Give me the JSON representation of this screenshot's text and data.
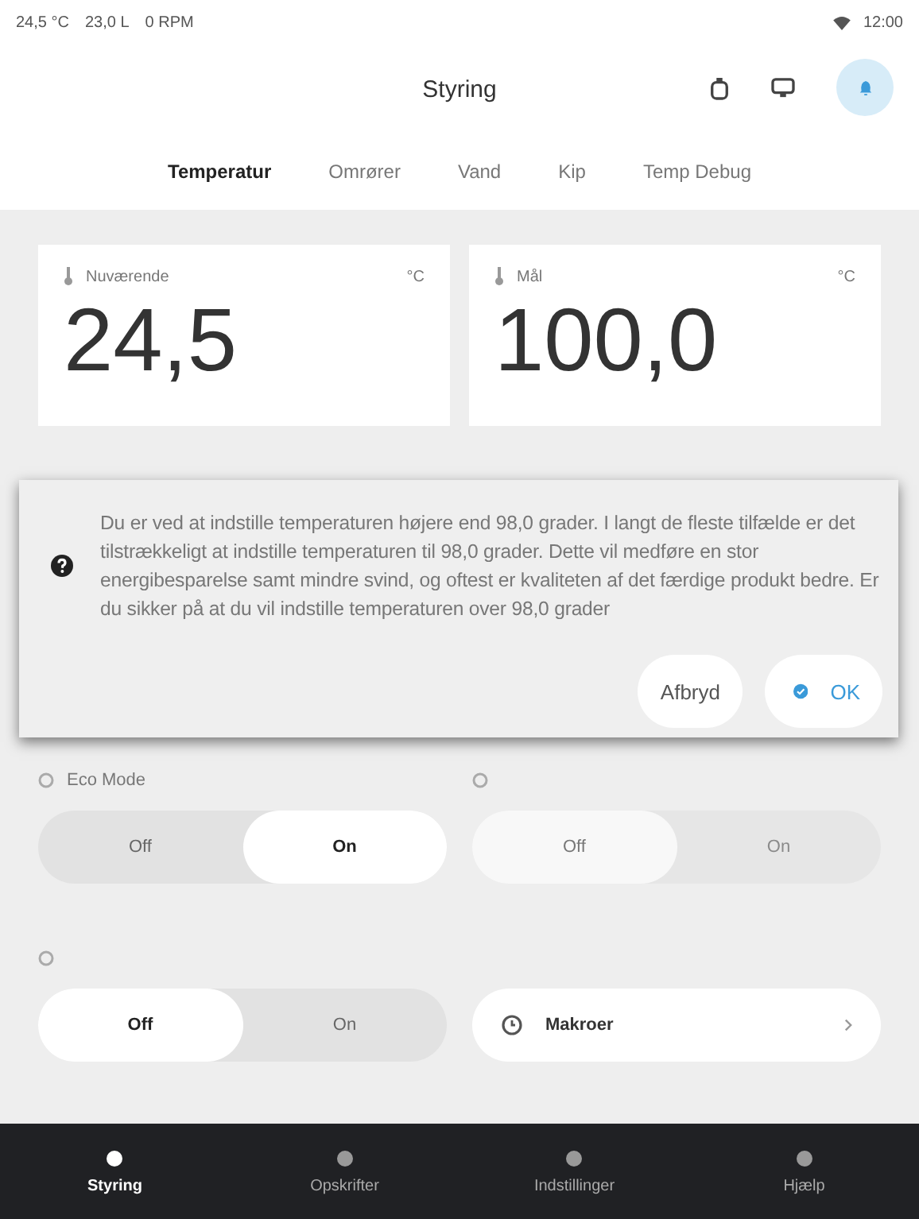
{
  "status_bar": {
    "readings": [
      "24,5 °C",
      "23,0 L",
      "0 RPM"
    ],
    "time": "12:00"
  },
  "app_bar": {
    "title": "Styring"
  },
  "tabs": [
    {
      "label": "Temperatur",
      "selected": true
    },
    {
      "label": "Omrører",
      "selected": false
    },
    {
      "label": "Vand",
      "selected": false
    },
    {
      "label": "Kip",
      "selected": false
    },
    {
      "label": "Temp Debug",
      "selected": false
    }
  ],
  "readouts": [
    {
      "label": "Nuværende",
      "unit": "°C",
      "value": "24,5"
    },
    {
      "label": "Mål",
      "unit": "°C",
      "value": "100,0"
    }
  ],
  "toggles": [
    {
      "label": "Eco Mode",
      "disabled": false,
      "options": [
        {
          "label": "Off",
          "selected": false
        },
        {
          "label": "On",
          "selected": true
        }
      ]
    },
    {
      "disabled": true,
      "options": [
        {
          "label": "Off",
          "selected": true
        },
        {
          "label": "On",
          "selected": false
        }
      ]
    },
    {
      "disabled": false,
      "options": [
        {
          "label": "Off",
          "selected": true
        },
        {
          "label": "On",
          "selected": false
        }
      ]
    }
  ],
  "macro_button": {
    "label": "Makroer"
  },
  "dialog": {
    "message": "Du er ved at indstille temperaturen højere end 98,0 grader. I langt de fleste tilfælde er det tilstrækkeligt at indstille temperaturen til 98,0 grader. Dette vil medføre en stor energibesparelse samt mindre svind, og oftest er kvaliteten af det færdige produkt bedre. Er du sikker på at du vil indstille temperaturen over 98,0 grader",
    "buttons": [
      {
        "label": "Afbryd",
        "kind": "cancel"
      },
      {
        "label": "OK",
        "kind": "confirm"
      }
    ]
  },
  "bottom_nav": [
    {
      "label": "Styring",
      "selected": true
    },
    {
      "label": "Opskrifter",
      "selected": false
    },
    {
      "label": "Indstillinger",
      "selected": false
    },
    {
      "label": "Hjælp",
      "selected": false
    }
  ]
}
